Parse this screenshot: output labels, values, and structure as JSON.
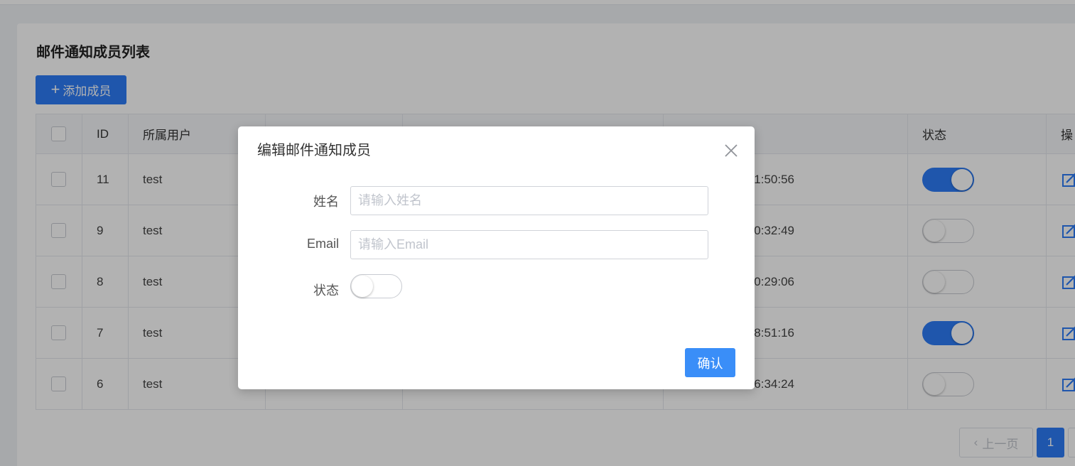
{
  "page": {
    "title": "邮件通知成员列表",
    "add_button_label": "添加成员",
    "add_button_icon": "plus-icon"
  },
  "table": {
    "headers": {
      "id": "ID",
      "user": "所属用户",
      "status": "状态",
      "actions": "操"
    },
    "rows": [
      {
        "id": "11",
        "user": "test",
        "time": "1:50:56",
        "status_on": true
      },
      {
        "id": "9",
        "user": "test",
        "time": "0:32:49",
        "status_on": false
      },
      {
        "id": "8",
        "user": "test",
        "time": "0:29:06",
        "status_on": false
      },
      {
        "id": "7",
        "user": "test",
        "time": "8:51:16",
        "status_on": true
      },
      {
        "id": "6",
        "user": "test",
        "time": "6:34:24",
        "status_on": false
      }
    ]
  },
  "pagination": {
    "prev_label": "上一页",
    "current_page": "1"
  },
  "modal": {
    "title": "编辑邮件通知成员",
    "name_label": "姓名",
    "name_placeholder": "请输入姓名",
    "name_value": "",
    "email_label": "Email",
    "email_placeholder": "请输入Email",
    "email_value": "",
    "status_label": "状态",
    "status_on": false,
    "confirm_label": "确认"
  },
  "colors": {
    "primary": "#2d7cf6",
    "confirm": "#3a8ef8"
  }
}
